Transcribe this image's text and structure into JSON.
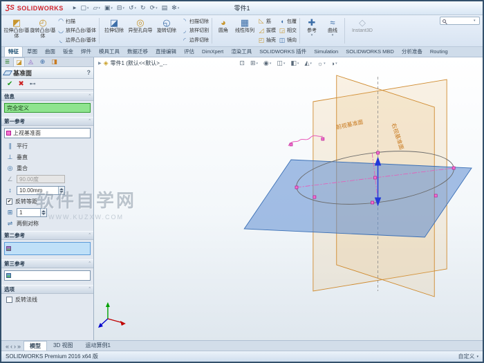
{
  "titlebar": {
    "brand_mark": "ƷS",
    "brand": "SOLIDWORKS",
    "doc_title": "零件1"
  },
  "icons": {
    "expand_arrow": "▶",
    "dropdown": "▾",
    "check": "✔",
    "cancel": "✖",
    "pin": "⊷",
    "help": "?",
    "chevron_up": "ˆ",
    "parallel": "∥",
    "perpendicular": "⊥",
    "coincident": "◎",
    "angle": "∠",
    "distance": "↕",
    "copies": "⊞",
    "midplane": "⇌",
    "tree_root_icon": "◈",
    "new": "▢",
    "open": "▱",
    "save": "▣",
    "print": "⊟",
    "undo": "↺",
    "redo": "↻",
    "rebuild": "⟳",
    "file_props": "▤",
    "options_gear": "✻",
    "extrude": "◩",
    "revolve": "◴",
    "sweep": "◠",
    "loft": "◡",
    "boundary": "◟",
    "cut_extrude": "◪",
    "hole_wizard": "◎",
    "cut_revolve": "◵",
    "cut_sweep": "◝",
    "cut_loft": "◞",
    "cut_boundary": "◜",
    "fillet": "◕",
    "linear_pattern": "▦",
    "rib": "◺",
    "draft": "◿",
    "shell": "◰",
    "wrap": "◖",
    "intersect": "◲",
    "mirror": "◫",
    "reference": "✚",
    "curves": "≈",
    "instant3d": "◇",
    "pm_tab_1": "≣",
    "pm_tab_2": "◪",
    "pm_tab_3": "◬",
    "pm_tab_4": "⊕",
    "pm_tab_5": "◨",
    "hud_1": "⊡",
    "hud_2": "⊞",
    "hud_3": "◉",
    "hud_4": "◫",
    "hud_5": "◧",
    "hud_6": "◭",
    "hud_7": "☼",
    "hud_8": "◑",
    "nav_first": "«",
    "nav_prev": "‹",
    "nav_next": "›",
    "nav_last": "»"
  },
  "ribbon": {
    "tabs": [
      "特征",
      "草图",
      "曲面",
      "钣金",
      "焊件",
      "模具工具",
      "数据迁移",
      "直接编辑",
      "评估",
      "DimXpert",
      "渲染工具",
      "SOLIDWORKS 插件",
      "Simulation",
      "SOLIDWORKS MBD",
      "分析准备",
      "Routing"
    ],
    "buttons": {
      "extrude": "拉伸凸台/基体",
      "revolve": "旋转凸台/基体",
      "sweep": "扫描",
      "loft": "放样凸台/基体",
      "boundary": "边界凸台/基体",
      "cut_extrude": "拉伸切除",
      "hole_wizard": "异型孔向导",
      "cut_revolve": "旋转切除",
      "cut_sweep": "扫描切除",
      "cut_loft": "放样切割",
      "cut_boundary": "边界切除",
      "fillet": "圆角",
      "linear_pattern": "线性阵列",
      "rib": "筋",
      "draft": "拔模",
      "shell": "抽壳",
      "wrap": "包覆",
      "intersect": "相交",
      "mirror": "镜向",
      "reference": "参考",
      "curves": "曲线",
      "instant3d": "Instant3D"
    }
  },
  "pm": {
    "title": "基准面",
    "message": {
      "header": "信息",
      "status": "完全定义"
    },
    "first_ref": {
      "header": "第一参考",
      "selection": "上视基准面",
      "parallel": "平行",
      "perpendicular": "垂直",
      "coincident": "重合",
      "angle": "90.00度",
      "distance": "10.00mm",
      "flip_offset": "反转等距",
      "copies": "1",
      "midplane": "两侧对称"
    },
    "second_ref": {
      "header": "第二参考"
    },
    "third_ref": {
      "header": "第三参考"
    },
    "options": {
      "header": "选项",
      "flip_normal": "反转法线"
    }
  },
  "viewport": {
    "tree_root": "零件1 (默认<<默认>_...",
    "labels": {
      "front_plane": "前视基准面",
      "right_plane": "右视基准面"
    },
    "watermark": {
      "line1": "软件自学网",
      "line2": "WWW.KUZXW.COM"
    }
  },
  "bottom_bar": {
    "tabs": [
      "模型",
      "3D 视图",
      "运动算例1"
    ]
  },
  "status_bar": {
    "product": "SOLIDWORKS Premium 2016 x64 版",
    "customize": "自定义"
  },
  "colors": {
    "brand_red": "#d2232a",
    "message_green": "#8fe48f",
    "selection_blue": "#bfe0f8",
    "plane_orange": "#d08a30",
    "plane_blue": "#4a7cc0",
    "sketch_pink": "#e858b8"
  }
}
